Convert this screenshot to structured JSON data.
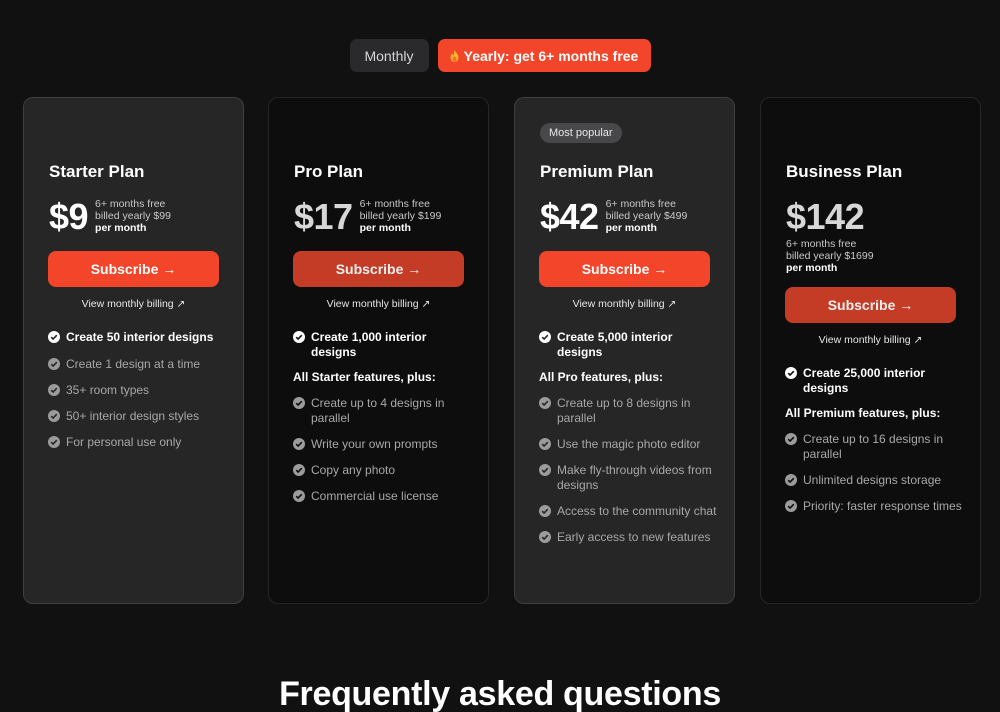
{
  "toggle": {
    "monthly_label": "Monthly",
    "yearly_label": "Yearly: get 6+ months free"
  },
  "colors": {
    "accent": "#f2452a",
    "accent_muted": "#c53c26",
    "background": "#111112",
    "card_light": "#262627",
    "card_dark": "#0d0d0e"
  },
  "plans": [
    {
      "name": "Starter Plan",
      "price": "$9",
      "note1": "6+ months free",
      "note2": "billed yearly $99",
      "per": "per month",
      "subscribe_label": "Subscribe →",
      "view_monthly": "View monthly billing ↗",
      "features": [
        "Create 50 interior designs",
        "Create 1 design at a time",
        "35+ room types",
        "50+ interior design styles",
        "For personal use only"
      ]
    },
    {
      "name": "Pro Plan",
      "price": "$17",
      "note1": "6+ months free",
      "note2": "billed yearly $199",
      "per": "per month",
      "subscribe_label": "Subscribe →",
      "view_monthly": "View monthly billing ↗",
      "headline": "Create 1,000 interior designs",
      "includes": "All Starter features, plus:",
      "features": [
        "Create up to 4 designs in parallel",
        "Write your own prompts",
        "Copy any photo",
        "Commercial use license"
      ]
    },
    {
      "badge": "Most popular",
      "name": "Premium Plan",
      "price": "$42",
      "note1": "6+ months free",
      "note2": "billed yearly $499",
      "per": "per month",
      "subscribe_label": "Subscribe →",
      "view_monthly": "View monthly billing ↗",
      "headline": "Create 5,000 interior designs",
      "includes": "All Pro features, plus:",
      "features": [
        "Create up to 8 designs in parallel",
        "Use the magic photo editor",
        "Make fly-through videos from designs",
        "Access to the community chat",
        "Early access to new features"
      ]
    },
    {
      "name": "Business Plan",
      "price": "$142",
      "note1": "6+ months free",
      "note2": "billed yearly $1699",
      "per": "per month",
      "subscribe_label": "Subscribe →",
      "view_monthly": "View monthly billing ↗",
      "headline": "Create 25,000 interior designs",
      "includes": "All Premium features, plus:",
      "features": [
        "Create up to 16 designs in parallel",
        "Unlimited designs storage",
        "Priority: faster response times"
      ]
    }
  ],
  "faq": {
    "title": "Frequently asked questions"
  }
}
